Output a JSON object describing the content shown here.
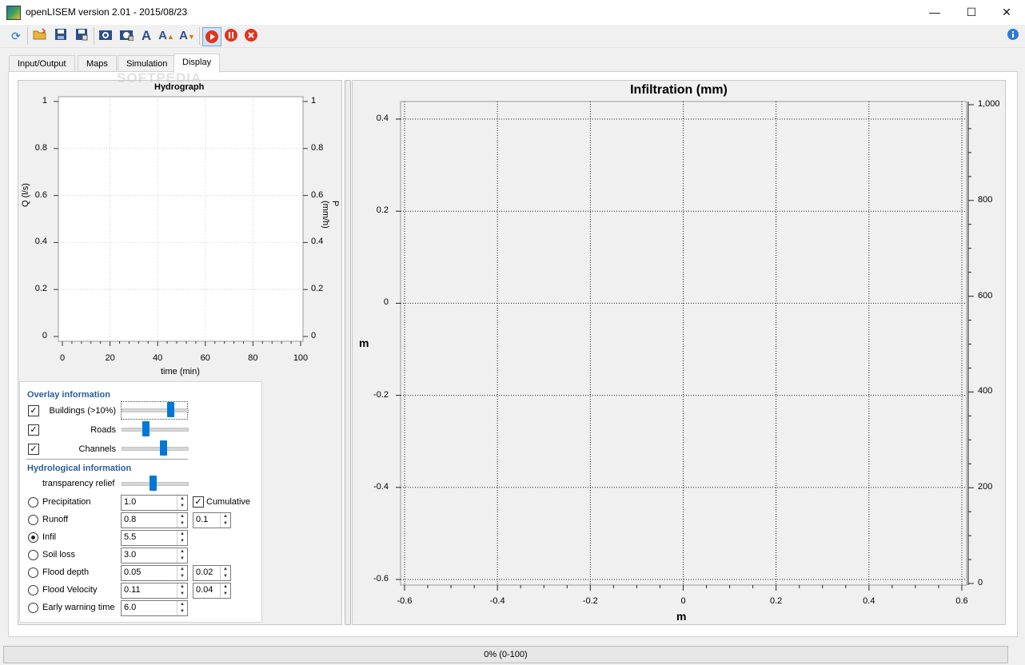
{
  "window": {
    "title": "openLISEM version 2.01 - 2015/08/23",
    "minimize": "—",
    "maximize": "☐",
    "close": "✕"
  },
  "toolbar": {
    "icons": [
      "refresh-icon",
      "open-folder-icon",
      "save-icon",
      "save-as-icon",
      "screenshot-icon",
      "screenshot-all-icon",
      "font-icon",
      "font-increase-icon",
      "font-decrease-icon",
      "run-icon",
      "pause-icon",
      "stop-icon",
      "info-icon"
    ]
  },
  "tabs": [
    {
      "label": "Input/Output",
      "active": false
    },
    {
      "label": "Maps",
      "active": false
    },
    {
      "label": "Simulation",
      "active": false
    },
    {
      "label": "Display",
      "active": true
    }
  ],
  "watermark": "SOFTPEDIA",
  "hydrograph": {
    "title": "Hydrograph",
    "ylabel_left": "Q (l/s)",
    "ylabel_right": "P (mm/h)",
    "xlabel": "time (min)",
    "y_ticks": [
      "1",
      "0.8",
      "0.6",
      "0.4",
      "0.2",
      "0"
    ],
    "x_ticks": [
      "0",
      "20",
      "40",
      "60",
      "80",
      "100"
    ]
  },
  "map": {
    "title": "Infiltration (mm)",
    "ylabel": "m",
    "xlabel": "m",
    "y_ticks": [
      "0.4",
      "0.2",
      "0",
      "-0.2",
      "-0.4",
      "-0.6"
    ],
    "x_ticks": [
      "-0.6",
      "-0.4",
      "-0.2",
      "0",
      "0.2",
      "0.4",
      "0.6"
    ],
    "colorbar_ticks": [
      "1,000",
      "800",
      "600",
      "400",
      "200",
      "0"
    ]
  },
  "overlay": {
    "section_title": "Overlay information",
    "items": [
      {
        "label": "Buildings (>10%)",
        "checked": true,
        "slider": 0.78
      },
      {
        "label": "Roads",
        "checked": true,
        "slider": 0.36
      },
      {
        "label": "Channels",
        "checked": true,
        "slider": 0.66
      }
    ]
  },
  "hydro": {
    "section_title": "Hydrological information",
    "transparency_label": "transparency relief",
    "transparency_value": 0.48,
    "cumulative_label": "Cumulative",
    "cumulative_checked": true,
    "rows": [
      {
        "label": "Precipitation",
        "value": "1.0",
        "value2": null,
        "selected": false
      },
      {
        "label": "Runoff",
        "value": "0.8",
        "value2": "0.1",
        "selected": false
      },
      {
        "label": "Infil",
        "value": "5.5",
        "value2": null,
        "selected": true
      },
      {
        "label": "Soil loss",
        "value": "3.0",
        "value2": null,
        "selected": false
      },
      {
        "label": "Flood depth",
        "value": "0.05",
        "value2": "0.02",
        "selected": false
      },
      {
        "label": "Flood Velocity",
        "value": "0.11",
        "value2": "0.04",
        "selected": false
      },
      {
        "label": "Early warning time",
        "value": "6.0",
        "value2": null,
        "selected": false
      }
    ]
  },
  "status": {
    "progress_text": "0% (0-100)",
    "progress": 0
  }
}
